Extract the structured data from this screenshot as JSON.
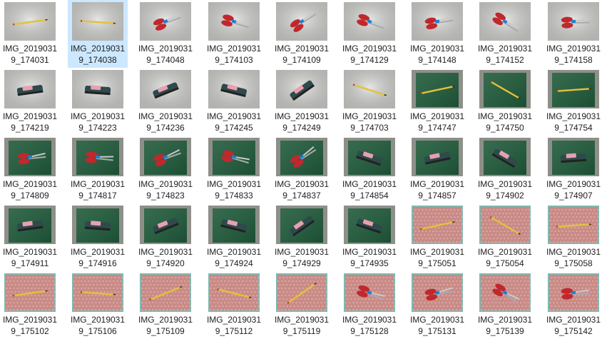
{
  "files": [
    {
      "name": "IMG_20190319_174031",
      "line1": "IMG_2019031",
      "line2": "9_174031",
      "scene": "pencil-white",
      "selected": false
    },
    {
      "name": "IMG_20190319_174038",
      "line1": "IMG_2019031",
      "line2": "9_174038",
      "scene": "pencil-white",
      "selected": true
    },
    {
      "name": "IMG_20190319_174048",
      "line1": "IMG_2019031",
      "line2": "9_174048",
      "scene": "scissors-white",
      "selected": false
    },
    {
      "name": "IMG_20190319_174103",
      "line1": "IMG_2019031",
      "line2": "9_174103",
      "scene": "scissors-white",
      "selected": false
    },
    {
      "name": "IMG_20190319_174109",
      "line1": "IMG_2019031",
      "line2": "9_174109",
      "scene": "scissors-white",
      "selected": false
    },
    {
      "name": "IMG_20190319_174129",
      "line1": "IMG_2019031",
      "line2": "9_174129",
      "scene": "scissors-white",
      "selected": false
    },
    {
      "name": "IMG_20190319_174148",
      "line1": "IMG_2019031",
      "line2": "9_174148",
      "scene": "scissors-white",
      "selected": false
    },
    {
      "name": "IMG_20190319_174152",
      "line1": "IMG_2019031",
      "line2": "9_174152",
      "scene": "scissors-white",
      "selected": false
    },
    {
      "name": "IMG_20190319_174158",
      "line1": "IMG_2019031",
      "line2": "9_174158",
      "scene": "scissors-white",
      "selected": false
    },
    {
      "name": "IMG_20190319_174219",
      "line1": "IMG_2019031",
      "line2": "9_174219",
      "scene": "stapler-white",
      "selected": false
    },
    {
      "name": "IMG_20190319_174223",
      "line1": "IMG_2019031",
      "line2": "9_174223",
      "scene": "stapler-white",
      "selected": false
    },
    {
      "name": "IMG_20190319_174236",
      "line1": "IMG_2019031",
      "line2": "9_174236",
      "scene": "stapler-white",
      "selected": false
    },
    {
      "name": "IMG_20190319_174245",
      "line1": "IMG_2019031",
      "line2": "9_174245",
      "scene": "stapler-white",
      "selected": false
    },
    {
      "name": "IMG_20190319_174249",
      "line1": "IMG_2019031",
      "line2": "9_174249",
      "scene": "stapler-white",
      "selected": false
    },
    {
      "name": "IMG_20190319_174703",
      "line1": "IMG_2019031",
      "line2": "9_174703",
      "scene": "pencil-white",
      "selected": false
    },
    {
      "name": "IMG_20190319_174747",
      "line1": "IMG_2019031",
      "line2": "9_174747",
      "scene": "pencil-green",
      "selected": false
    },
    {
      "name": "IMG_20190319_174750",
      "line1": "IMG_2019031",
      "line2": "9_174750",
      "scene": "pencil-green",
      "selected": false
    },
    {
      "name": "IMG_20190319_174754",
      "line1": "IMG_2019031",
      "line2": "9_174754",
      "scene": "pencil-green",
      "selected": false
    },
    {
      "name": "IMG_20190319_174809",
      "line1": "IMG_2019031",
      "line2": "9_174809",
      "scene": "scissors-green",
      "selected": false
    },
    {
      "name": "IMG_20190319_174817",
      "line1": "IMG_2019031",
      "line2": "9_174817",
      "scene": "scissors-green",
      "selected": false
    },
    {
      "name": "IMG_20190319_174823",
      "line1": "IMG_2019031",
      "line2": "9_174823",
      "scene": "scissors-green",
      "selected": false
    },
    {
      "name": "IMG_20190319_174833",
      "line1": "IMG_2019031",
      "line2": "9_174833",
      "scene": "scissors-green",
      "selected": false
    },
    {
      "name": "IMG_20190319_174837",
      "line1": "IMG_2019031",
      "line2": "9_174837",
      "scene": "scissors-green",
      "selected": false
    },
    {
      "name": "IMG_20190319_174854",
      "line1": "IMG_2019031",
      "line2": "9_174854",
      "scene": "stapler-green",
      "selected": false
    },
    {
      "name": "IMG_20190319_174857",
      "line1": "IMG_2019031",
      "line2": "9_174857",
      "scene": "stapler-green",
      "selected": false
    },
    {
      "name": "IMG_20190319_174902",
      "line1": "IMG_2019031",
      "line2": "9_174902",
      "scene": "stapler-green",
      "selected": false
    },
    {
      "name": "IMG_20190319_174907",
      "line1": "IMG_2019031",
      "line2": "9_174907",
      "scene": "stapler-green",
      "selected": false
    },
    {
      "name": "IMG_20190319_174911",
      "line1": "IMG_2019031",
      "line2": "9_174911",
      "scene": "stapler-green",
      "selected": false
    },
    {
      "name": "IMG_20190319_174916",
      "line1": "IMG_2019031",
      "line2": "9_174916",
      "scene": "stapler-green",
      "selected": false
    },
    {
      "name": "IMG_20190319_174920",
      "line1": "IMG_2019031",
      "line2": "9_174920",
      "scene": "stapler-green",
      "selected": false
    },
    {
      "name": "IMG_20190319_174924",
      "line1": "IMG_2019031",
      "line2": "9_174924",
      "scene": "stapler-green",
      "selected": false
    },
    {
      "name": "IMG_20190319_174929",
      "line1": "IMG_2019031",
      "line2": "9_174929",
      "scene": "stapler-green",
      "selected": false
    },
    {
      "name": "IMG_20190319_174935",
      "line1": "IMG_2019031",
      "line2": "9_174935",
      "scene": "stapler-green",
      "selected": false
    },
    {
      "name": "IMG_20190319_175051",
      "line1": "IMG_2019031",
      "line2": "9_175051",
      "scene": "pencil-bubble",
      "selected": false
    },
    {
      "name": "IMG_20190319_175054",
      "line1": "IMG_2019031",
      "line2": "9_175054",
      "scene": "pencil-bubble",
      "selected": false
    },
    {
      "name": "IMG_20190319_175058",
      "line1": "IMG_2019031",
      "line2": "9_175058",
      "scene": "pencil-bubble",
      "selected": false
    },
    {
      "name": "IMG_20190319_175102",
      "line1": "IMG_2019031",
      "line2": "9_175102",
      "scene": "pencil-bubble",
      "selected": false
    },
    {
      "name": "IMG_20190319_175106",
      "line1": "IMG_2019031",
      "line2": "9_175106",
      "scene": "pencil-bubble",
      "selected": false
    },
    {
      "name": "IMG_20190319_175109",
      "line1": "IMG_2019031",
      "line2": "9_175109",
      "scene": "pencil-bubble",
      "selected": false
    },
    {
      "name": "IMG_20190319_175112",
      "line1": "IMG_2019031",
      "line2": "9_175112",
      "scene": "pencil-bubble",
      "selected": false
    },
    {
      "name": "IMG_20190319_175119",
      "line1": "IMG_2019031",
      "line2": "9_175119",
      "scene": "pencil-bubble",
      "selected": false
    },
    {
      "name": "IMG_20190319_175128",
      "line1": "IMG_2019031",
      "line2": "9_175128",
      "scene": "scissors-bubble",
      "selected": false
    },
    {
      "name": "IMG_20190319_175131",
      "line1": "IMG_2019031",
      "line2": "9_175131",
      "scene": "scissors-bubble",
      "selected": false
    },
    {
      "name": "IMG_20190319_175139",
      "line1": "IMG_2019031",
      "line2": "9_175139",
      "scene": "scissors-bubble",
      "selected": false
    },
    {
      "name": "IMG_20190319_175142",
      "line1": "IMG_2019031",
      "line2": "9_175142",
      "scene": "scissors-bubble",
      "selected": false
    }
  ],
  "colors": {
    "selection": "#cce8ff",
    "label_text": "#1e1e1e",
    "white_background": "#d9d9d6",
    "green_notebook": "#1f5a3a",
    "bubble_wrap": "#c98a86",
    "scissors_handle": "#c0282d",
    "stapler_body": "#2e4a4c",
    "pencil": "#e2c23a"
  }
}
